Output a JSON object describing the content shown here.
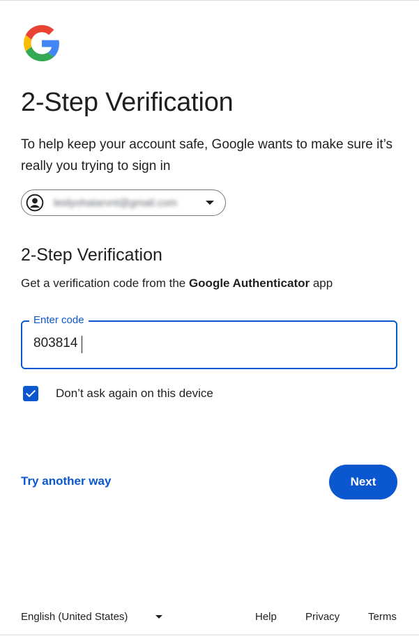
{
  "brand": {
    "logo_icon": "google-g-logo",
    "colors": {
      "blue": "#4285F4",
      "red": "#EA4335",
      "yellow": "#FBBC05",
      "green": "#34A853",
      "accent": "#0b57d0"
    }
  },
  "header": {
    "title": "2-Step Verification",
    "subtitle": "To help keep your account safe, Google wants to make sure it’s really you trying to sign in"
  },
  "account": {
    "icon": "account-circle-icon",
    "email": "leidyohatarvnt@gmail.com",
    "dropdown_icon": "caret-down-icon"
  },
  "verification": {
    "section_title": "2-Step Verification",
    "instructions_prefix": "Get a verification code from the ",
    "instructions_app": "Google Authenticator",
    "instructions_suffix": " app",
    "code_label": "Enter code",
    "code_value": "803814"
  },
  "remember": {
    "checked": true,
    "label": "Don’t ask again on this device"
  },
  "actions": {
    "try_another": "Try another way",
    "next": "Next"
  },
  "footer": {
    "language": "English (United States)",
    "help": "Help",
    "privacy": "Privacy",
    "terms": "Terms"
  }
}
